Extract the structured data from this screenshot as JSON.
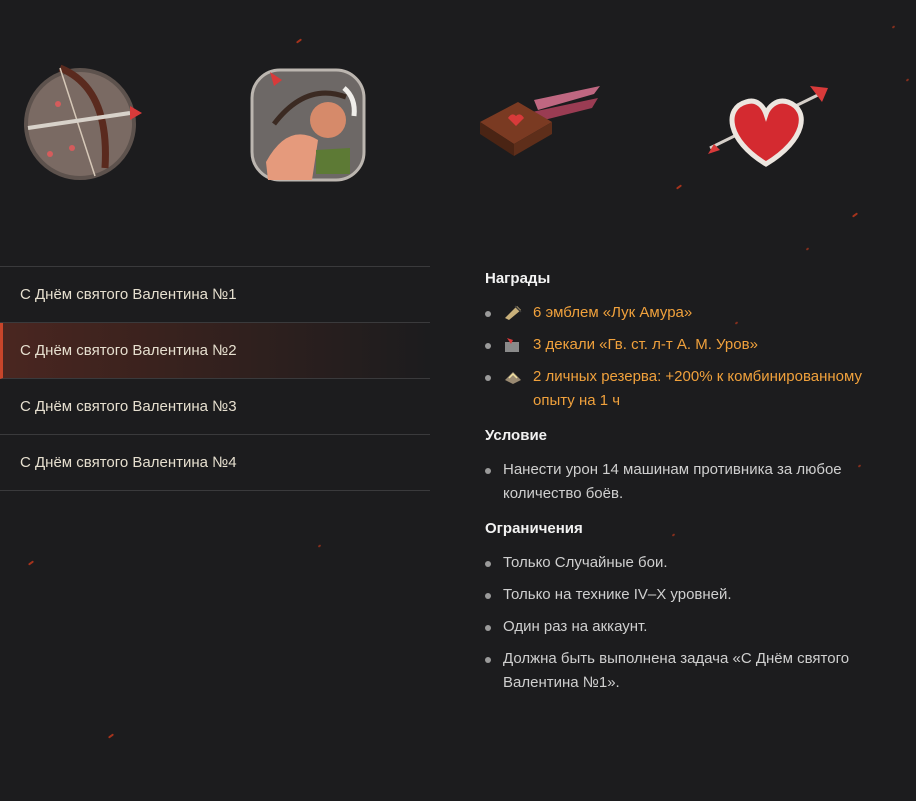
{
  "emblems": [
    {
      "name": "cupid-bow-emblem"
    },
    {
      "name": "archer-strongman-emblem"
    },
    {
      "name": "flying-box-emblem"
    },
    {
      "name": "heart-arrow-emblem"
    }
  ],
  "quests": [
    {
      "label": "С Днём святого Валентина №1",
      "active": false
    },
    {
      "label": "С Днём святого Валентина №2",
      "active": true
    },
    {
      "label": "С Днём святого Валентина №3",
      "active": false
    },
    {
      "label": "С Днём святого Валентина №4",
      "active": false
    }
  ],
  "details": {
    "rewards_title": "Награды",
    "rewards": [
      {
        "icon": "emblem-icon",
        "text": "6 эмблем «Лук Амура»"
      },
      {
        "icon": "decal-icon",
        "text": "3 декали «Гв. ст. л-т А. М. Уров»"
      },
      {
        "icon": "reserve-icon",
        "text": "2 личных резерва: +200% к комбинированному опыту на 1 ч"
      }
    ],
    "condition_title": "Условие",
    "conditions": [
      "Нанести урон 14 машинам противника за любое количество боёв."
    ],
    "limits_title": "Ограничения",
    "limits": [
      "Только Случайные бои.",
      "Только на технике IV–X уровней.",
      "Один раз на аккаунт.",
      "Должна быть выполнена задача «С Днём святого Валентина №1»."
    ]
  },
  "colors": {
    "background": "#1c1c1e",
    "reward_text": "#f0a13c",
    "active_accent": "#c8452a"
  }
}
